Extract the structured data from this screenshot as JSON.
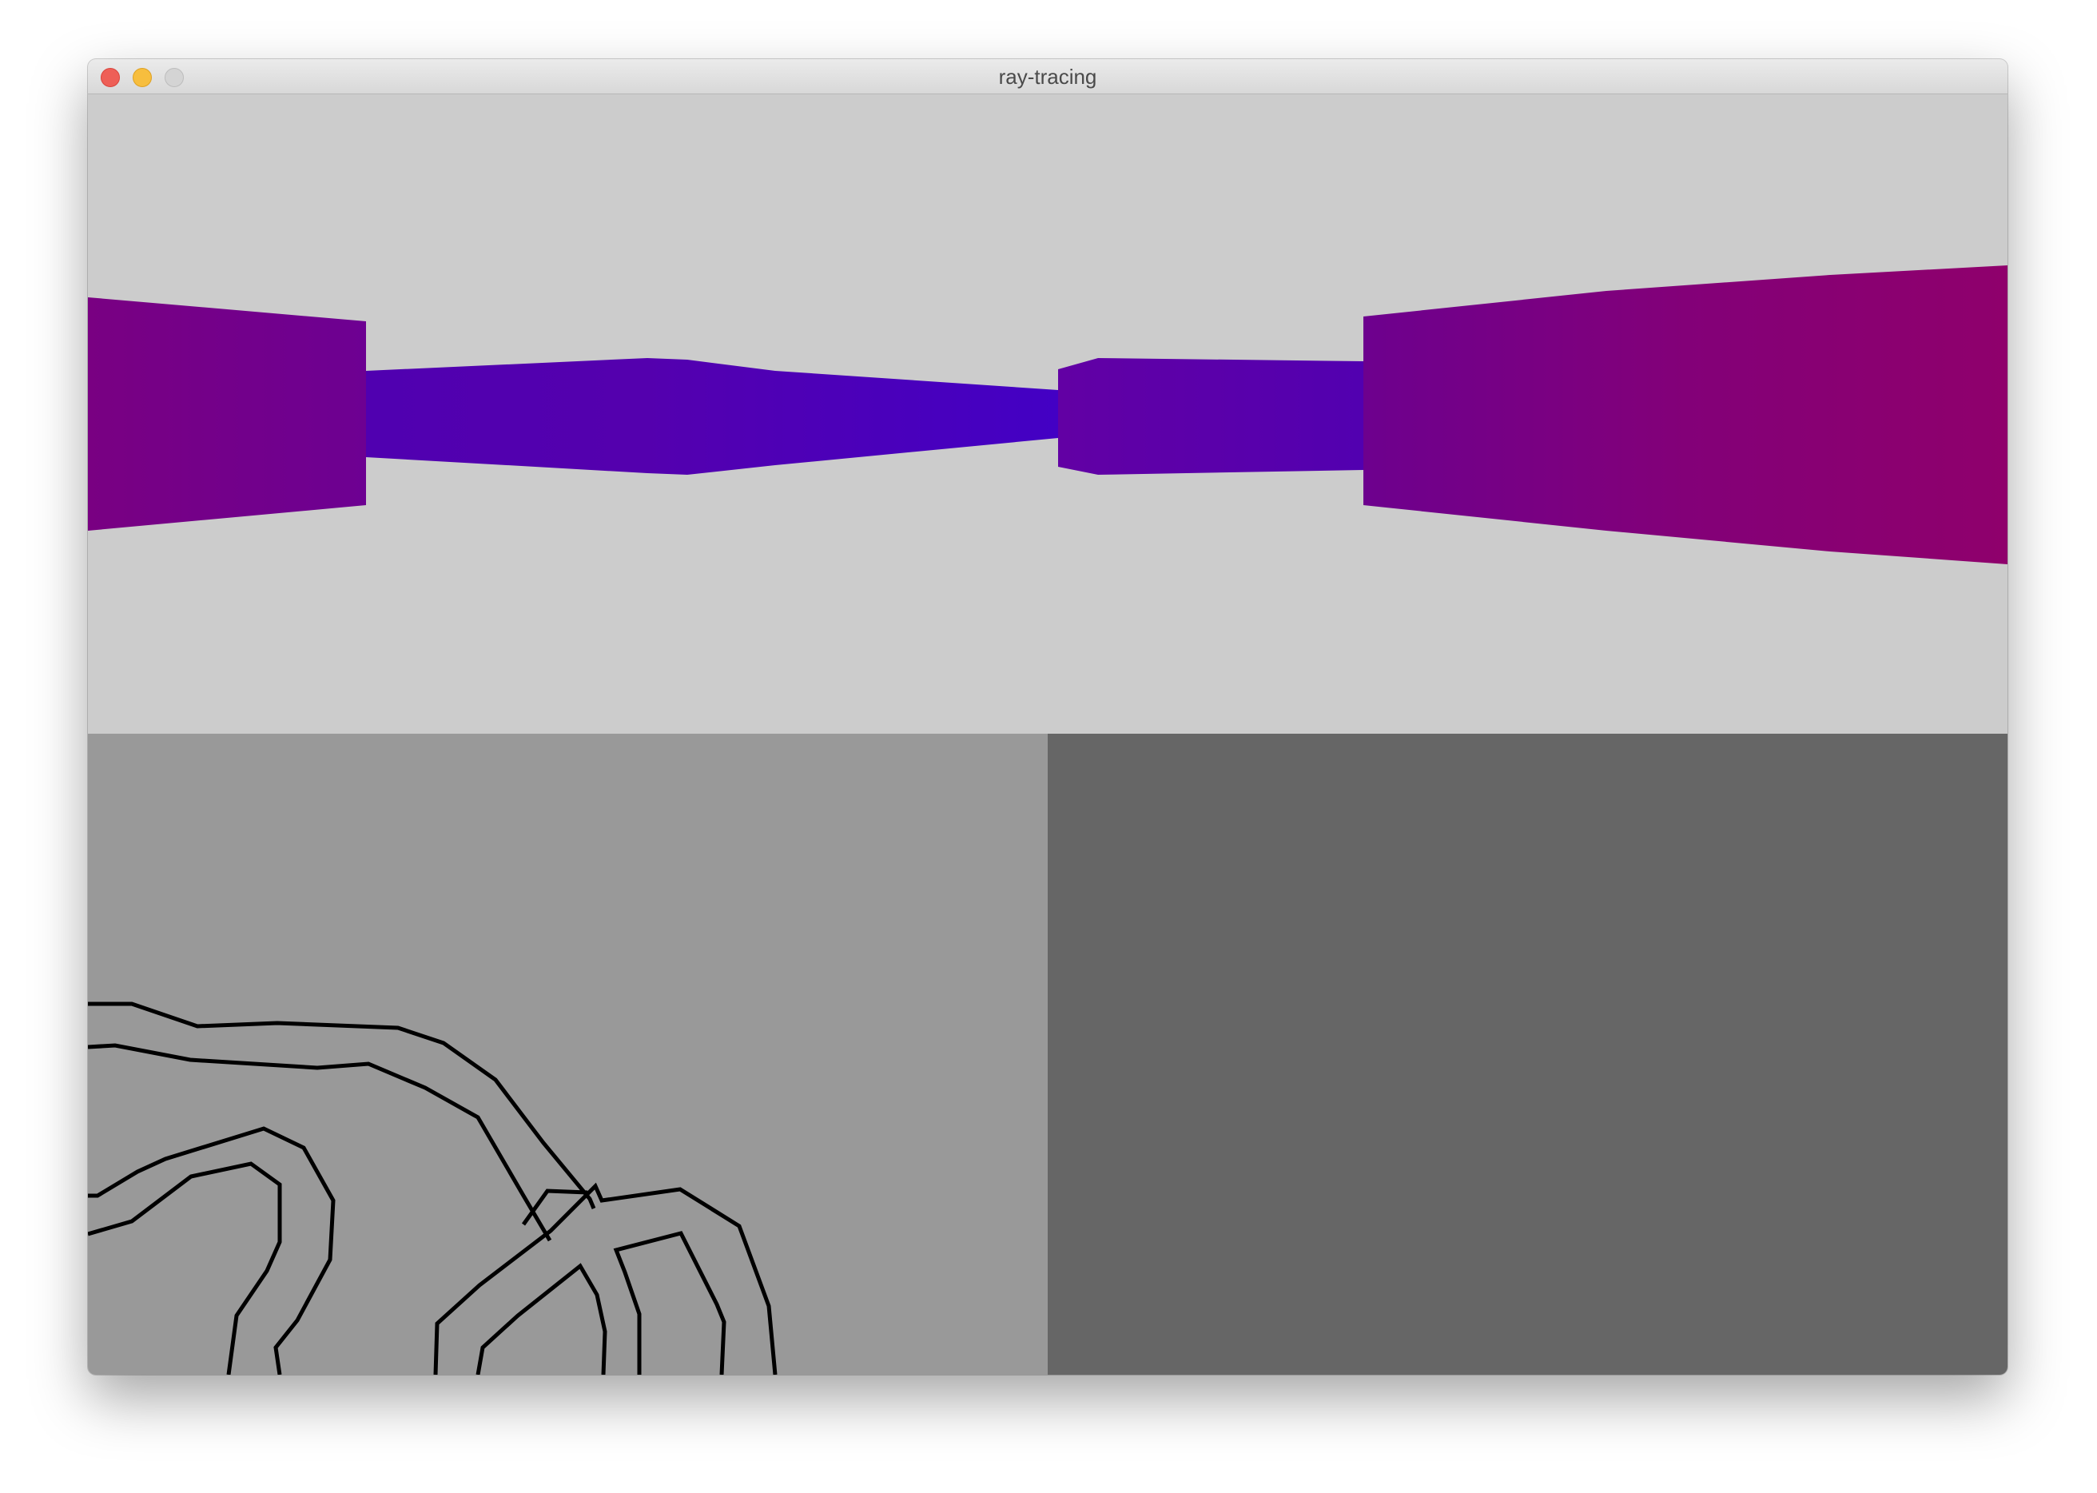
{
  "window": {
    "title": "ray-tracing",
    "controls": {
      "close_color": "#ee5f57",
      "minimize_color": "#f7be3e",
      "zoom_color": "#d4d4d4"
    }
  },
  "scene": {
    "background_color": "#cccccc",
    "wall_colors": {
      "near": "#8e0070",
      "mid": "#7a0088",
      "far": "#4300c4"
    }
  },
  "panels": {
    "map_background": "#999999",
    "secondary_background": "#666666",
    "path_color": "#000000"
  }
}
